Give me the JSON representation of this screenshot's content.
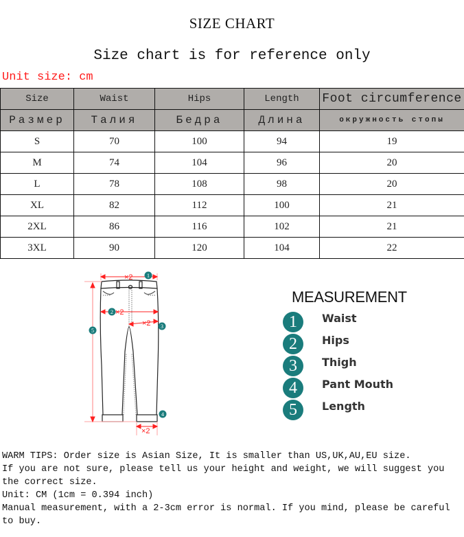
{
  "header": {
    "title": "SIZE CHART",
    "subtitle": "Size chart is for reference only",
    "unit_note": "Unit size: cm"
  },
  "table": {
    "columns_en": [
      "Size",
      "Waist",
      "Hips",
      "Length",
      "Foot circumference"
    ],
    "columns_ru": [
      "Размер",
      "Талия",
      "Бедра",
      "Длина",
      "окружность стопы"
    ],
    "rows": [
      [
        "S",
        "70",
        "100",
        "94",
        "19"
      ],
      [
        "M",
        "74",
        "104",
        "96",
        "20"
      ],
      [
        "L",
        "78",
        "108",
        "98",
        "20"
      ],
      [
        "XL",
        "82",
        "112",
        "100",
        "21"
      ],
      [
        "2XL",
        "86",
        "116",
        "102",
        "21"
      ],
      [
        "3XL",
        "90",
        "120",
        "104",
        "22"
      ]
    ]
  },
  "diagram": {
    "annotations": {
      "waist": "×2",
      "hips": "×2",
      "thigh": "×2",
      "pant_mouth": "×2"
    },
    "markers": [
      "1",
      "2",
      "3",
      "4",
      "5"
    ],
    "colors": {
      "line": "#ff2020",
      "badge": "#1a7c7c"
    }
  },
  "measurement": {
    "title": "MEASUREMENT",
    "items": [
      {
        "num": "1",
        "label": "Waist"
      },
      {
        "num": "2",
        "label": "Hips"
      },
      {
        "num": "3",
        "label": "Thigh"
      },
      {
        "num": "4",
        "label": "Pant Mouth"
      },
      {
        "num": "5",
        "label": "Length"
      }
    ]
  },
  "tips": [
    "WARM TIPS: Order size is Asian Size, It is smaller than US,UK,AU,EU size.",
    "If you are not sure, please tell us your height and weight, we will suggest you the correct size.",
    "Unit: CM (1cm = 0.394 inch)",
    "Manual measurement, with a 2-3cm error is normal. If you mind, please be careful to buy."
  ]
}
